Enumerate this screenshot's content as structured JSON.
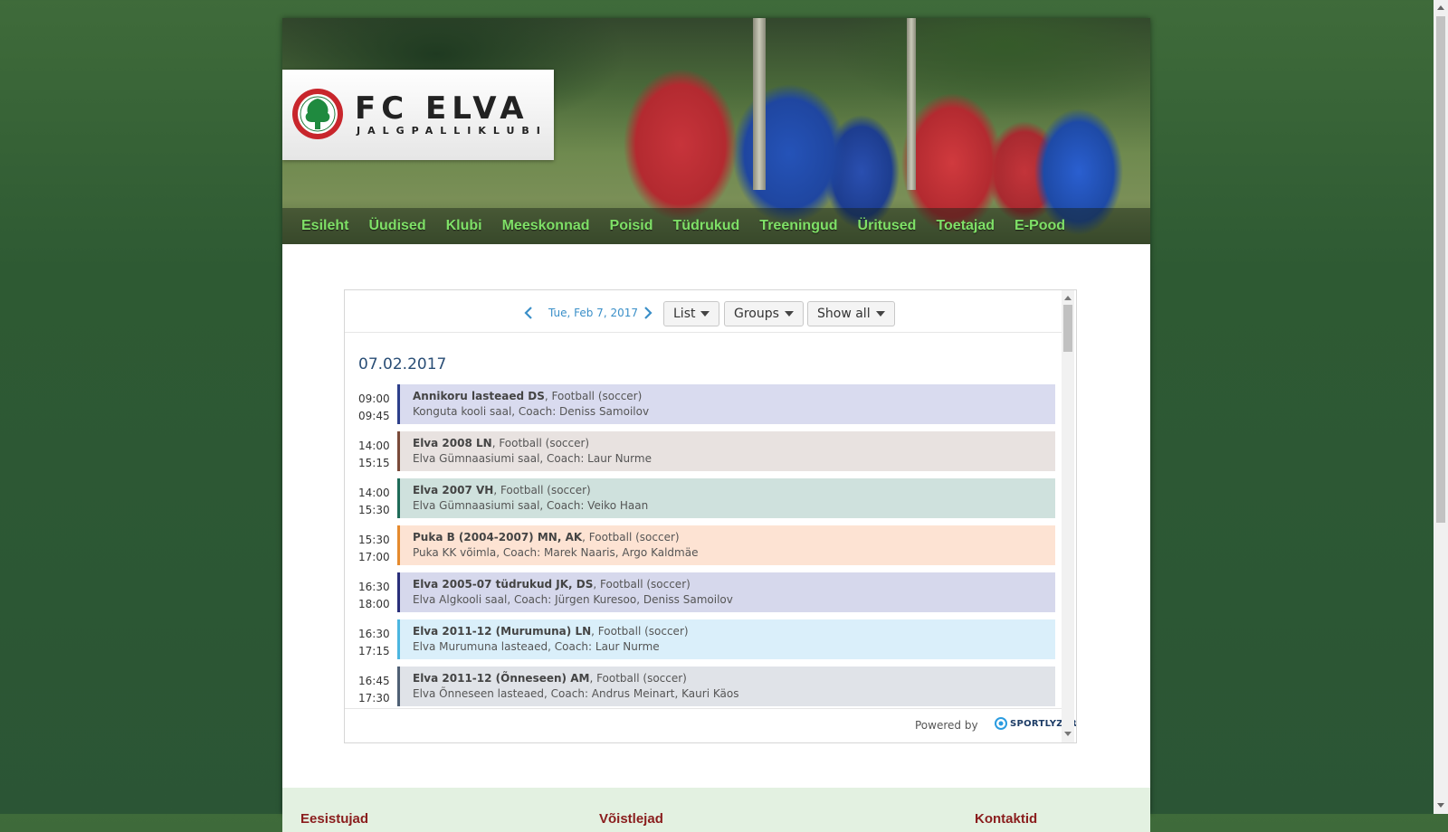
{
  "site": {
    "logo_name": "FC ELVA",
    "logo_sub": "JALGPALLIKLUBI",
    "nav": [
      "Esileht",
      "Üudised",
      "Klubi",
      "Meeskonnad",
      "Poisid",
      "Tüdrukud",
      "Treeningud",
      "Üritused",
      "Toetajad",
      "E-Pood"
    ],
    "nav_color": "#7fe067"
  },
  "schedule": {
    "date_label": "Tue, Feb 7, 2017",
    "view_dropdown": "List",
    "groups_dropdown": "Groups",
    "show_dropdown": "Show all",
    "day_heading": "07.02.2017",
    "events": [
      {
        "start": "09:00",
        "end": "09:45",
        "group": "Annikoru lasteaed DS",
        "sport": ", Football (soccer)",
        "details": "Konguta kooli saal, Coach: Deniss Samoilov",
        "bg": "#d9dbef",
        "border": "#2d3f8a"
      },
      {
        "start": "14:00",
        "end": "15:15",
        "group": "Elva 2008 LN",
        "sport": ", Football (soccer)",
        "details": "Elva Gümnaasiumi saal, Coach: Laur Nurme",
        "bg": "#e8e2e0",
        "border": "#7a4a3a"
      },
      {
        "start": "14:00",
        "end": "15:30",
        "group": "Elva 2007 VH",
        "sport": ", Football (soccer)",
        "details": "Elva Gümnaasiumi saal, Coach: Veiko Haan",
        "bg": "#cfe1dd",
        "border": "#1f6b58"
      },
      {
        "start": "15:30",
        "end": "17:00",
        "group": "Puka B (2004-2007) MN, AK",
        "sport": ", Football (soccer)",
        "details": "Puka KK võimla, Coach: Marek Naaris, Argo Kaldmäe",
        "bg": "#fde3d3",
        "border": "#e58a2e"
      },
      {
        "start": "16:30",
        "end": "18:00",
        "group": "Elva 2005-07 tüdrukud JK, DS",
        "sport": ", Football (soccer)",
        "details": "Elva Algkooli saal, Coach: Jürgen Kuresoo, Deniss Samoilov",
        "bg": "#d6d8ec",
        "border": "#2a2f7a"
      },
      {
        "start": "16:30",
        "end": "17:15",
        "group": "Elva 2011-12 (Murumuna) LN",
        "sport": ", Football (soccer)",
        "details": "Elva Murumuna lasteaed, Coach: Laur Nurme",
        "bg": "#daeffa",
        "border": "#4cb6e0"
      },
      {
        "start": "16:45",
        "end": "17:30",
        "group": "Elva 2011-12 (Õnneseen) AM",
        "sport": ", Football (soccer)",
        "details": "Elva Õnneseen lasteaed, Coach: Andrus Meinart, Kauri Käos",
        "bg": "#e0e3e8",
        "border": "#4f6075"
      }
    ],
    "powered_by": "Powered by",
    "brand": "SPORTLYZER"
  },
  "lower": {
    "col1": "Eesistujad",
    "col2": "Võistlejad",
    "col3": "Kontaktid"
  }
}
